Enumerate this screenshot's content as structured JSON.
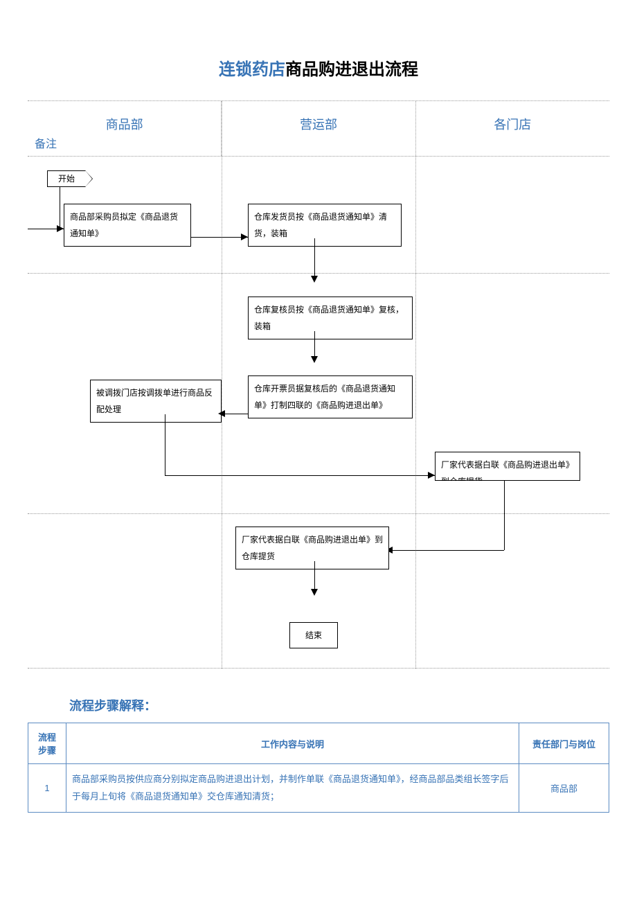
{
  "title_blue_left": "连锁药店",
  "title_black": "商品购进退出流程",
  "headers": {
    "col1": "商品部",
    "col2": "营运部",
    "col3": "各门店",
    "note": "备注"
  },
  "nodes": {
    "start": "开始",
    "a1": "商品部采购员拟定《商品退货通知单》",
    "b1": "仓库发货员按《商品退货通知单》清货，装箱",
    "b2": "仓库复核员按《商品退货通知单》复核，装箱",
    "b3": "仓库开票员据复核后的《商品退货通知单》打制四联的《商品购进退出单》",
    "a2": "被调拨门店按调拨单进行商品反配处理",
    "c1": "厂家代表据白联《商品购进退出单》到仓库提货",
    "b4": "厂家代表据白联《商品购进退出单》到仓库提货",
    "end": "结束"
  },
  "section": "流程步骤解释：",
  "table": {
    "h1": "流程步骤",
    "h2": "工作内容与说明",
    "h3": "责任部门与岗位",
    "rows": [
      {
        "step": "1",
        "desc": "商品部采购员按供应商分别拟定商品购进退出计划，并制作单联《商品退货通知单》，经商品部品类组长签字后于每月上旬将《商品退货通知单》交仓库通知清货；",
        "resp": "商品部"
      }
    ]
  },
  "chart_data": {
    "type": "flowchart",
    "swimlanes": [
      "商品部",
      "营运部",
      "各门店"
    ],
    "nodes": [
      {
        "id": "start",
        "type": "terminator",
        "label": "开始",
        "lane": "商品部"
      },
      {
        "id": "a1",
        "type": "process",
        "label": "商品部采购员拟定《商品退货通知单》",
        "lane": "商品部"
      },
      {
        "id": "b1",
        "type": "process",
        "label": "仓库发货员按《商品退货通知单》清货，装箱",
        "lane": "营运部"
      },
      {
        "id": "b2",
        "type": "process",
        "label": "仓库复核员按《商品退货通知单》复核，装箱",
        "lane": "营运部"
      },
      {
        "id": "b3",
        "type": "process",
        "label": "仓库开票员据复核后的《商品退货通知单》打制四联的《商品购进退出单》",
        "lane": "营运部"
      },
      {
        "id": "a2",
        "type": "process",
        "label": "被调拨门店按调拨单进行商品反配处理",
        "lane": "商品部"
      },
      {
        "id": "c1",
        "type": "process",
        "label": "厂家代表据白联《商品购进退出单》到仓库提货",
        "lane": "各门店"
      },
      {
        "id": "b4",
        "type": "process",
        "label": "厂家代表据白联《商品购进退出单》到仓库提货",
        "lane": "营运部"
      },
      {
        "id": "end",
        "type": "terminator",
        "label": "结束",
        "lane": "营运部"
      }
    ],
    "edges": [
      {
        "from": "start",
        "to": "a1"
      },
      {
        "from": "a1",
        "to": "b1"
      },
      {
        "from": "b1",
        "to": "b2"
      },
      {
        "from": "b2",
        "to": "b3"
      },
      {
        "from": "b3",
        "to": "a2"
      },
      {
        "from": "b3",
        "to": "c1"
      },
      {
        "from": "c1",
        "to": "b4"
      },
      {
        "from": "b4",
        "to": "end"
      }
    ]
  }
}
